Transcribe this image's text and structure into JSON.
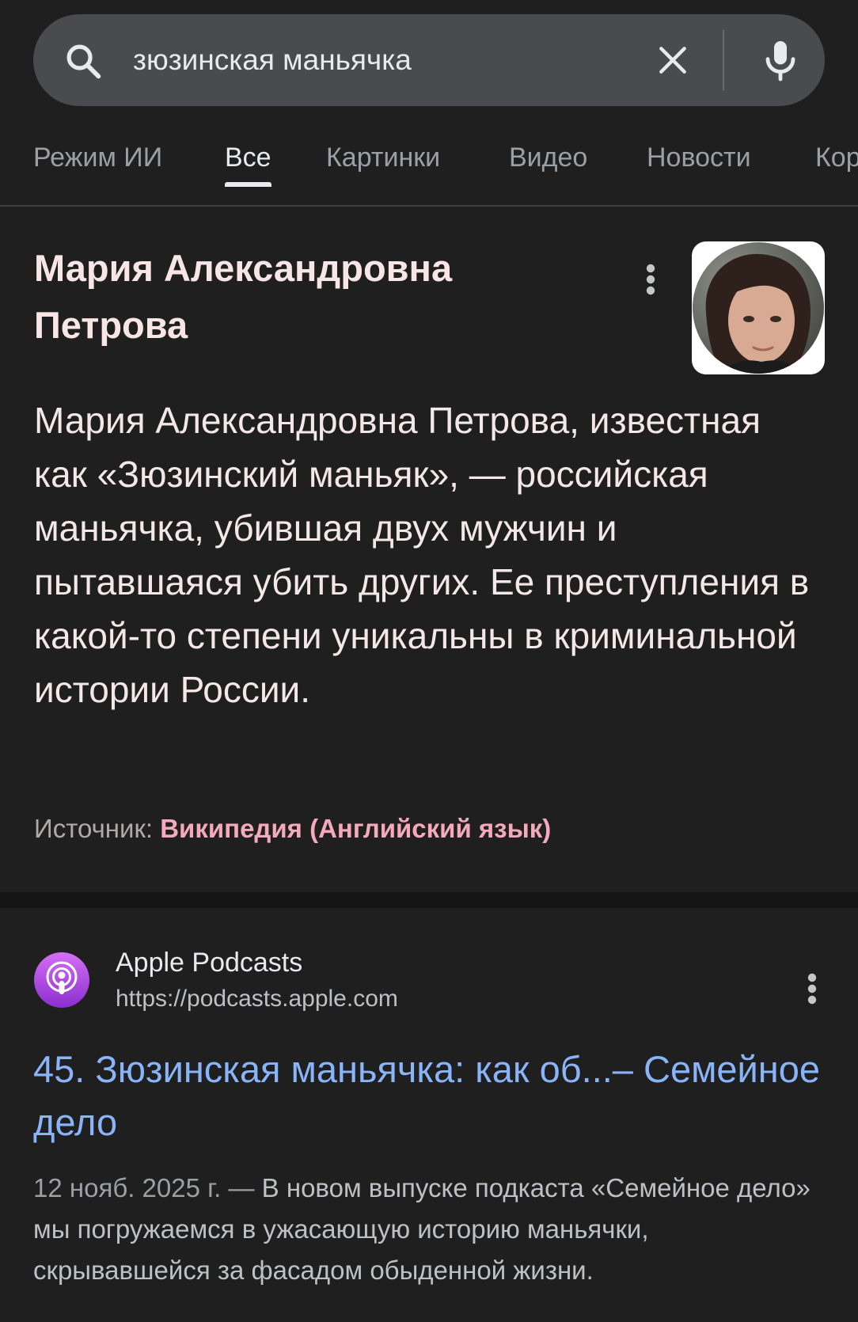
{
  "search": {
    "query": "зюзинская маньячка"
  },
  "tabs": [
    {
      "label": "Режим ИИ",
      "active": false
    },
    {
      "label": "Все",
      "active": true
    },
    {
      "label": "Картинки",
      "active": false
    },
    {
      "label": "Видео",
      "active": false
    },
    {
      "label": "Новости",
      "active": false
    },
    {
      "label": "Кор",
      "active": false
    }
  ],
  "knowledge_panel": {
    "title_line1": "Мария Александровна",
    "title_line2": "Петрова",
    "description": "Мария Александровна Петрова, известная как «Зюзинский маньяк», — российская маньячка, убившая двух мужчин и пытавшаяся убить других. Ее преступления в какой-то степени уникальны в криминальной истории России.",
    "source_label": "Источник:",
    "source_link": "Википедия (Английский язык)"
  },
  "result": {
    "site_name": "Apple Podcasts",
    "url": "https://podcasts.apple.com",
    "title": "45. Зюзинская маньячка: как об...– Семейное дело",
    "date": "12 нояб. 2025 г. —",
    "snippet": "В новом выпуске подкаста «Семейное дело» мы погружаемся в ужасающую историю маньячки, скрывавшейся за фасадом обыденной жизни."
  },
  "colors": {
    "background": "#1f1f1f",
    "search_bar": "#4a4b4f",
    "link_blue": "#8ab4f8",
    "source_pink": "#f4a9bc",
    "podcast_purple": "#b150e2"
  },
  "icons": [
    "search-icon",
    "clear-icon",
    "mic-icon",
    "more-vert-icon",
    "podcast-icon"
  ]
}
